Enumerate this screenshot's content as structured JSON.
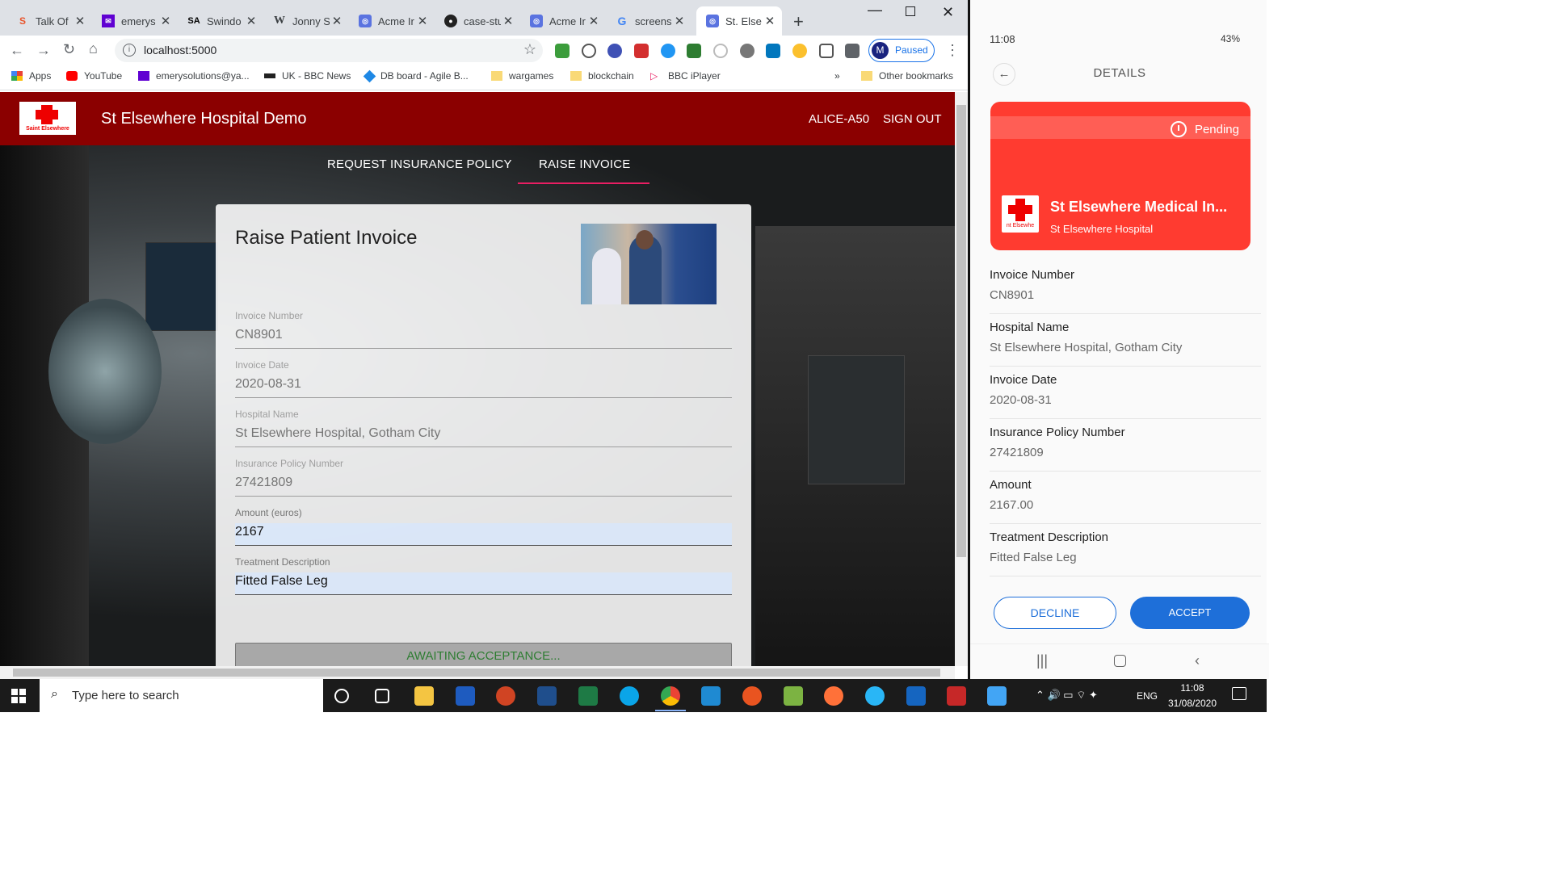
{
  "browser": {
    "tabs": [
      {
        "title": "Talk Of",
        "icon": "s-icon"
      },
      {
        "title": "emerys",
        "icon": "mail-icon"
      },
      {
        "title": "Swindo",
        "icon": "sa-icon"
      },
      {
        "title": "Jonny S",
        "icon": "wikipedia-icon"
      },
      {
        "title": "Acme Ir",
        "icon": "acme-icon"
      },
      {
        "title": "case-stu",
        "icon": "github-icon"
      },
      {
        "title": "Acme Ir",
        "icon": "acme-icon"
      },
      {
        "title": "screens",
        "icon": "google-icon"
      },
      {
        "title": "St. Else",
        "icon": "acme-icon"
      }
    ],
    "url": "localhost:5000",
    "profile_initial": "M",
    "profile_status": "Paused",
    "bookmarks": [
      {
        "label": "Apps"
      },
      {
        "label": "YouTube"
      },
      {
        "label": "emerysolutions@ya..."
      },
      {
        "label": "UK - BBC News"
      },
      {
        "label": "DB board - Agile B..."
      },
      {
        "label": "wargames"
      },
      {
        "label": "blockchain"
      },
      {
        "label": "BBC iPlayer"
      },
      {
        "label": "»"
      },
      {
        "label": "Other bookmarks"
      }
    ]
  },
  "app": {
    "title": "St Elsewhere Hospital Demo",
    "logo_text": "Saint Elsewhere",
    "user": "ALICE-A50",
    "sign_out": "SIGN OUT",
    "nav_tabs": [
      "REQUEST INSURANCE POLICY",
      "RAISE INVOICE"
    ],
    "active_tab": "RAISE INVOICE",
    "accent_color": "#8b0000"
  },
  "form": {
    "title": "Raise Patient Invoice",
    "fields": [
      {
        "label": "Invoice Number",
        "value": "CN8901"
      },
      {
        "label": "Invoice Date",
        "value": "2020-08-31"
      },
      {
        "label": "Hospital Name",
        "value": "St Elsewhere Hospital, Gotham City"
      },
      {
        "label": "Insurance Policy Number",
        "value": "27421809"
      },
      {
        "label": "Amount (euros)",
        "value": "2167"
      },
      {
        "label": "Treatment Description",
        "value": "Fitted False Leg"
      }
    ],
    "status_button": "AWAITING ACCEPTANCE..."
  },
  "phone": {
    "time": "11:08",
    "battery": "43%",
    "title": "DETAILS",
    "status": "Pending",
    "card_name": "St Elsewhere Medical In...",
    "card_sub": "St Elsewhere Hospital",
    "card_logo_text": "nt Elsewhe",
    "card_color": "#ff3b30",
    "fields": [
      {
        "label": "Invoice Number",
        "value": "CN8901"
      },
      {
        "label": "Hospital Name",
        "value": "St Elsewhere Hospital, Gotham City"
      },
      {
        "label": "Invoice Date",
        "value": "2020-08-31"
      },
      {
        "label": "Insurance Policy Number",
        "value": "27421809"
      },
      {
        "label": "Amount",
        "value": "2167.00"
      },
      {
        "label": "Treatment Description",
        "value": "Fitted False Leg"
      }
    ],
    "decline": "DECLINE",
    "accept": "ACCEPT"
  },
  "taskbar": {
    "search_placeholder": "Type here to search",
    "language": "ENG",
    "time": "11:08",
    "date": "31/08/2020"
  }
}
